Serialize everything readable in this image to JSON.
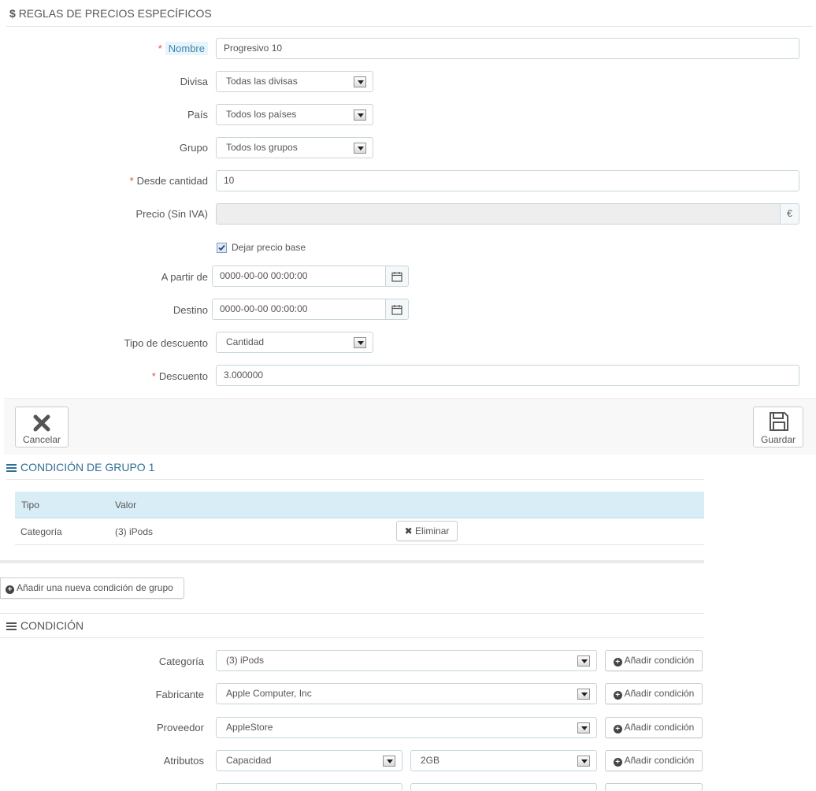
{
  "section1": {
    "icon": "dollar-icon",
    "title_symbol": "$",
    "title": "REGLAS DE PRECIOS ESPECÍFICOS"
  },
  "form": {
    "nombre": {
      "label": "Nombre",
      "value": "Progresivo 10"
    },
    "divisa": {
      "label": "Divisa",
      "value": "Todas las divisas"
    },
    "pais": {
      "label": "País",
      "value": "Todos los países"
    },
    "grupo": {
      "label": "Grupo",
      "value": "Todos los grupos"
    },
    "desde": {
      "label": "Desde cantidad",
      "value": "10"
    },
    "precio": {
      "label": "Precio (Sin IVA)",
      "value": "",
      "addon": "€"
    },
    "dejar": {
      "label": "Dejar precio base",
      "checked": true
    },
    "apartir": {
      "label": "A partir de",
      "value": "0000-00-00 00:00:00"
    },
    "destino": {
      "label": "Destino",
      "value": "0000-00-00 00:00:00"
    },
    "tipo": {
      "label": "Tipo de descuento",
      "value": "Cantidad"
    },
    "descuento": {
      "label": "Descuento",
      "value": "3.000000"
    }
  },
  "footer": {
    "cancel_label": "Cancelar",
    "save_label": "Guardar"
  },
  "group_condition": {
    "title": "CONDICIÓN DE GRUPO 1",
    "headers": [
      "Tipo",
      "Valor"
    ],
    "row": {
      "tipo": "Categoría",
      "valor": "(3) iPods",
      "delete_label": "Eliminar"
    }
  },
  "add_group_label": "Añadir una nueva condición de grupo",
  "condition": {
    "title": "CONDICIÓN",
    "add_label": "Añadir condición",
    "categoria": {
      "label": "Categoría",
      "value": "(3) iPods"
    },
    "fabricante": {
      "label": "Fabricante",
      "value": "Apple Computer, Inc"
    },
    "proveedor": {
      "label": "Proveedor",
      "value": "AppleStore"
    },
    "atributos": {
      "label": "Atributos",
      "value1": "Capacidad",
      "value2": "2GB"
    }
  },
  "colors": {
    "accent": "#25b9d7",
    "heading_blue": "#2f6f97",
    "table_header": "#d9edf7",
    "required": "#e74c3c"
  }
}
